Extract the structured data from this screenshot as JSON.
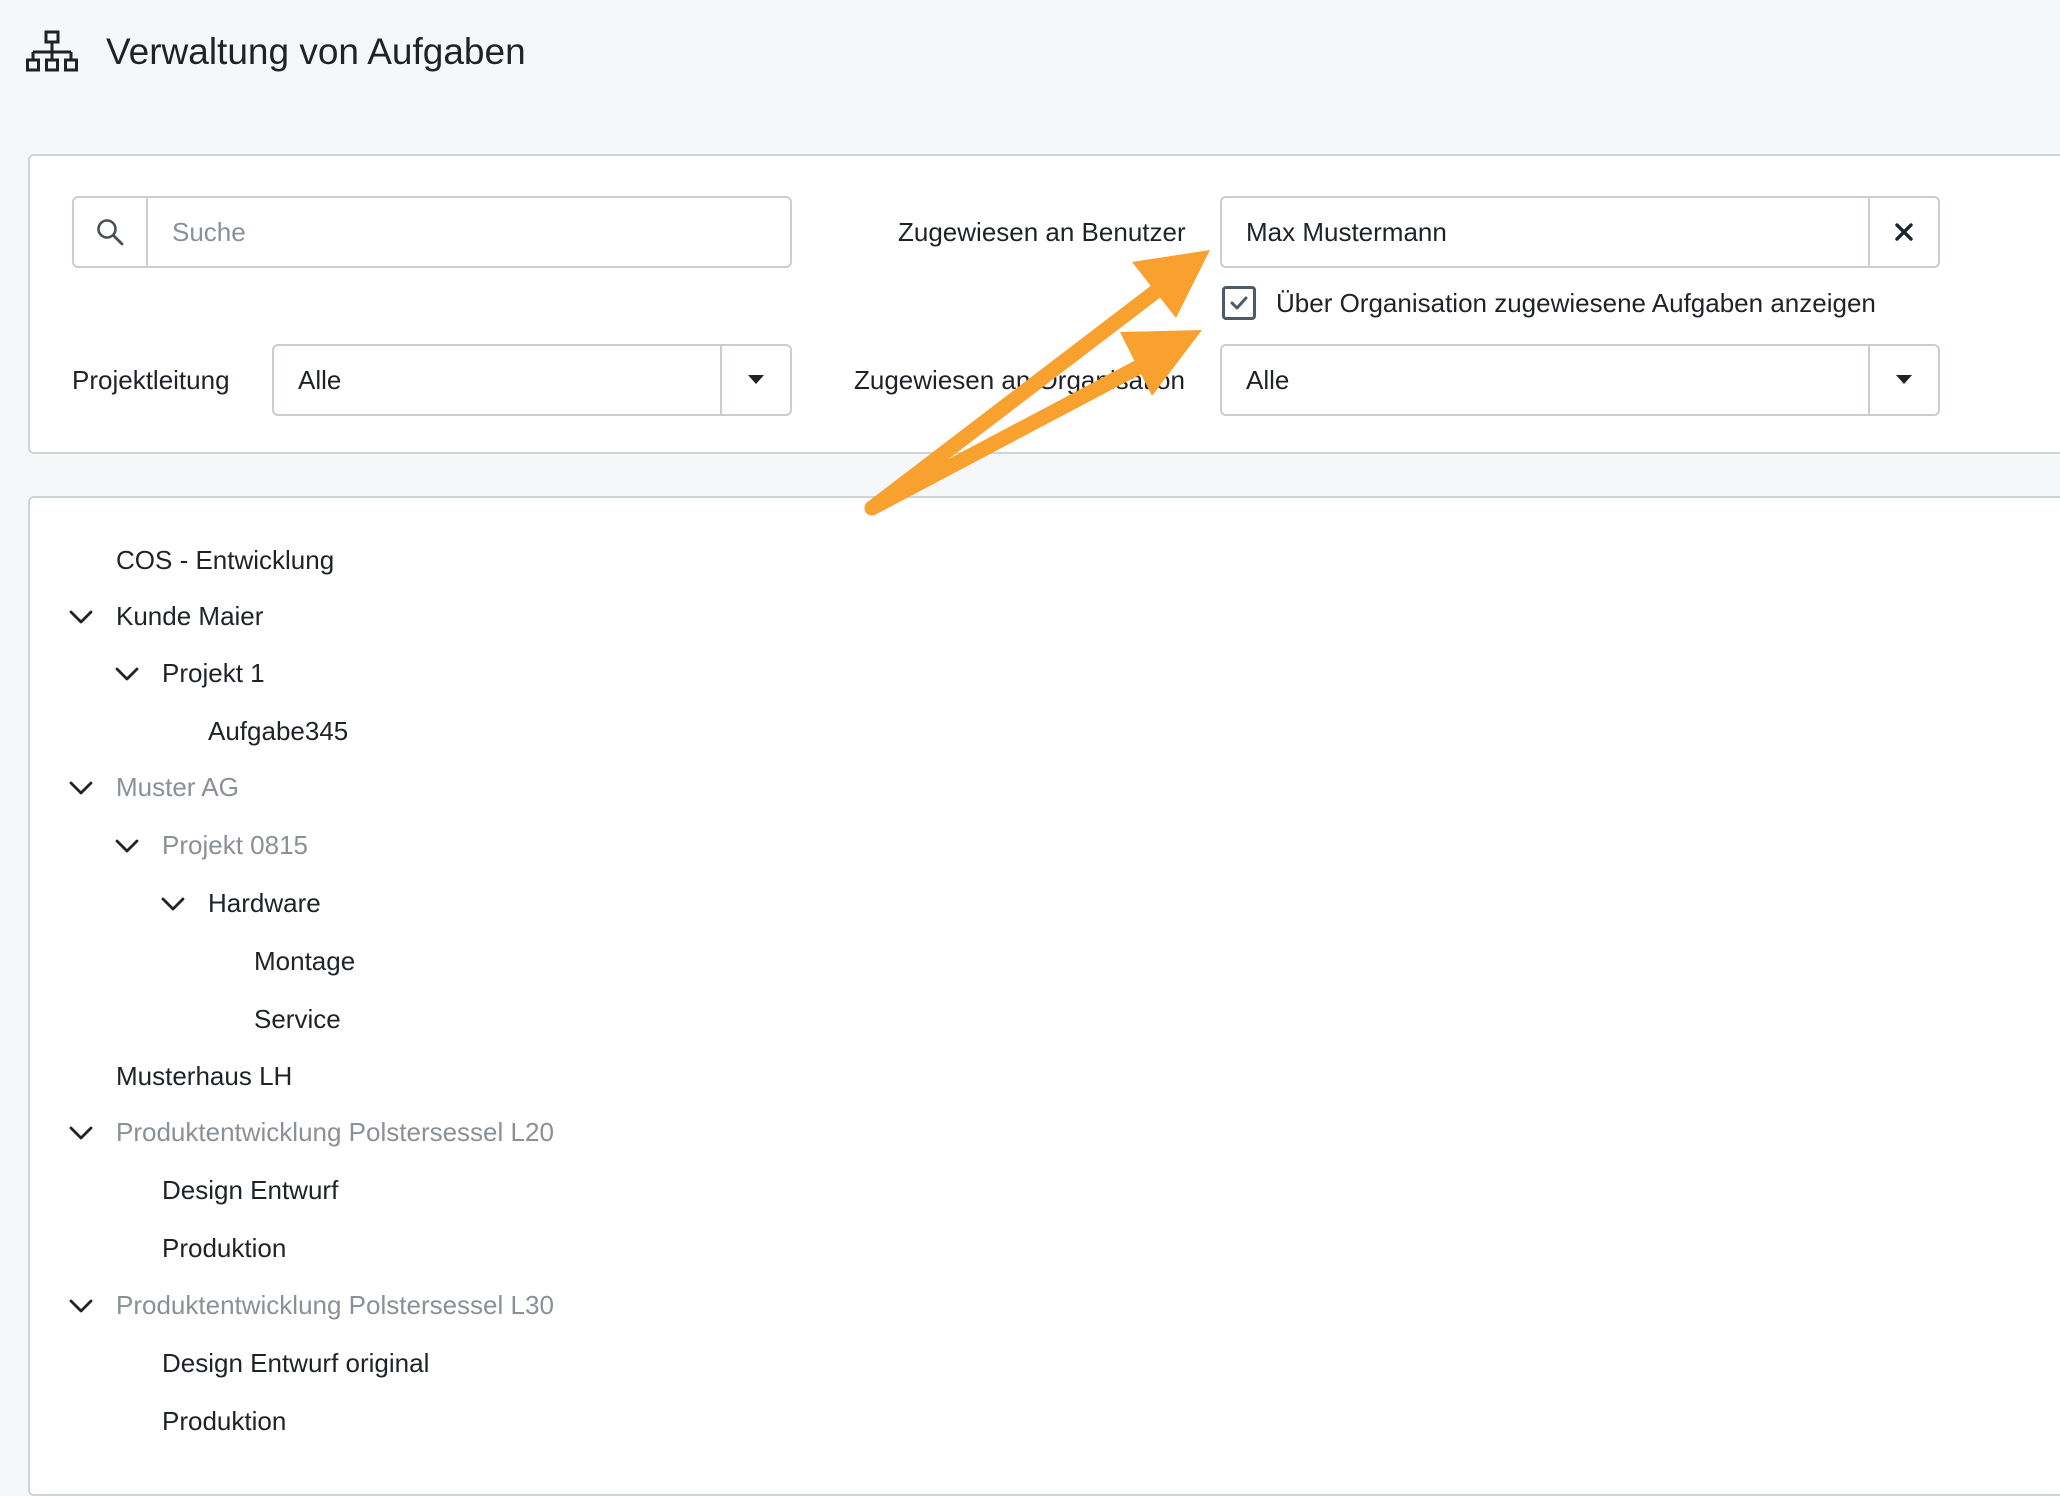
{
  "header": {
    "icon": "sitemap-icon",
    "title": "Verwaltung von Aufgaben"
  },
  "filters": {
    "search": {
      "icon": "search-icon",
      "placeholder": "Suche",
      "value": ""
    },
    "assigned_user": {
      "label": "Zugewiesen an Benutzer",
      "value": "Max Mustermann",
      "clear_icon": "close-icon"
    },
    "show_org_tasks": {
      "label": "Über Organisation zugewiesene Aufgaben anzeigen",
      "checked": true
    },
    "project_lead": {
      "label": "Projektleitung",
      "value": "Alle",
      "icon": "caret-down-icon"
    },
    "assigned_org": {
      "label": "Zugewiesen an Organisation",
      "value": "Alle",
      "icon": "caret-down-icon"
    }
  },
  "tree": {
    "items": [
      {
        "label": "COS - Entwicklung",
        "level": 0,
        "expanded": null,
        "muted": false
      },
      {
        "label": "Kunde Maier",
        "level": 0,
        "expanded": true,
        "muted": false
      },
      {
        "label": "Projekt 1",
        "level": 1,
        "expanded": true,
        "muted": false
      },
      {
        "label": "Aufgabe345",
        "level": 2,
        "expanded": null,
        "muted": false
      },
      {
        "label": "Muster AG",
        "level": 0,
        "expanded": true,
        "muted": true
      },
      {
        "label": "Projekt 0815",
        "level": 1,
        "expanded": true,
        "muted": true
      },
      {
        "label": "Hardware",
        "level": 2,
        "expanded": true,
        "muted": false
      },
      {
        "label": "Montage",
        "level": 3,
        "expanded": null,
        "muted": false
      },
      {
        "label": "Service",
        "level": 3,
        "expanded": null,
        "muted": false
      },
      {
        "label": "Musterhaus LH",
        "level": 0,
        "expanded": null,
        "muted": false
      },
      {
        "label": "Produktentwicklung Polstersessel L20",
        "level": 0,
        "expanded": true,
        "muted": true
      },
      {
        "label": "Design Entwurf",
        "level": 1,
        "expanded": null,
        "muted": false
      },
      {
        "label": "Produktion",
        "level": 1,
        "expanded": null,
        "muted": false
      },
      {
        "label": "Produktentwicklung Polstersessel L30",
        "level": 0,
        "expanded": true,
        "muted": true
      },
      {
        "label": "Design Entwurf original",
        "level": 1,
        "expanded": null,
        "muted": false
      },
      {
        "label": "Produktion",
        "level": 1,
        "expanded": null,
        "muted": false
      }
    ]
  },
  "annotation": {
    "color": "#f8a12f",
    "arrows": [
      "arrow-to-user-field",
      "arrow-to-org-checkbox"
    ]
  },
  "colors": {
    "muted_text": "#8b9096",
    "border": "#c9ced4",
    "background": "#f6f7f9",
    "checkbox": "#4a5c6a"
  }
}
